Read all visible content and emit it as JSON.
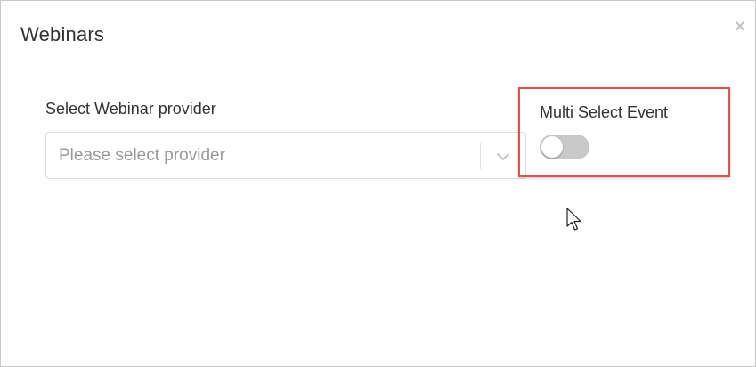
{
  "modal": {
    "title": "Webinars",
    "close_glyph": "×"
  },
  "provider": {
    "label": "Select Webinar provider",
    "placeholder": "Please select provider",
    "dropdown_icon": "chevron-down-icon"
  },
  "multi_select": {
    "label": "Multi Select Event",
    "enabled": false
  },
  "colors": {
    "highlight": "#d9534f",
    "toggle_off": "#c9c9c9"
  }
}
